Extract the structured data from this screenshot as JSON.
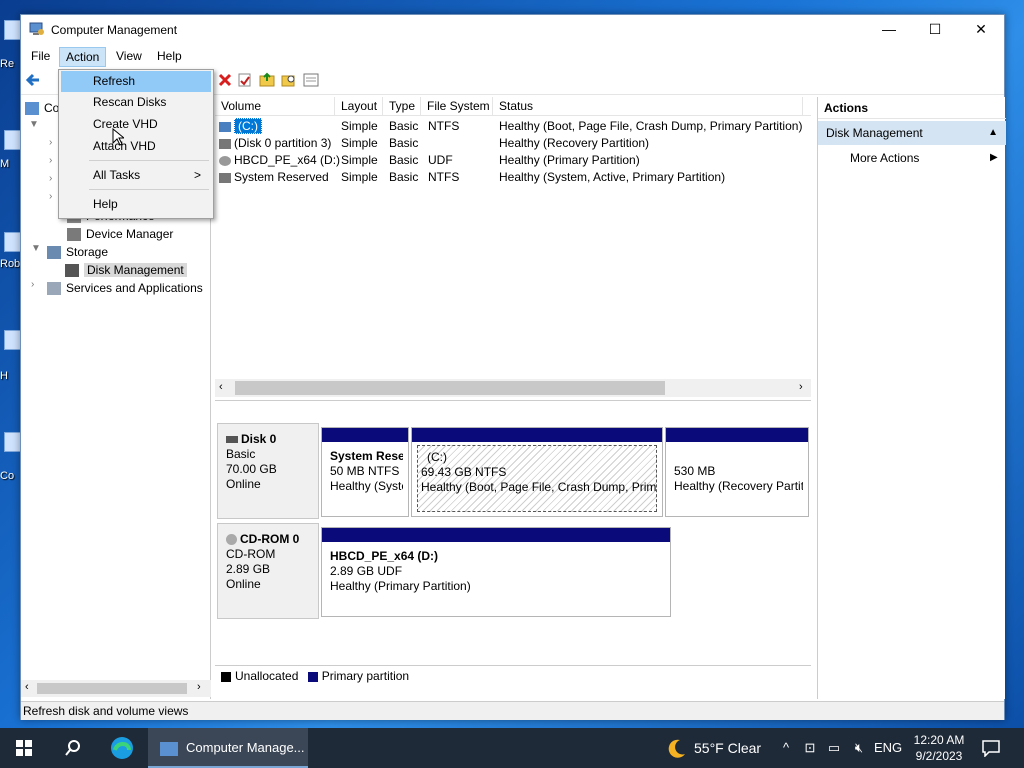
{
  "window": {
    "title": "Computer Management",
    "controls": {
      "minimize": "—",
      "maximize": "☐",
      "close": "✕"
    }
  },
  "menubar": {
    "items": [
      "File",
      "Action",
      "View",
      "Help"
    ]
  },
  "action_menu": {
    "items": [
      "Refresh",
      "Rescan Disks",
      "Create VHD",
      "Attach VHD",
      "All Tasks",
      "Help"
    ],
    "all_tasks_arrow": ">"
  },
  "tree": {
    "root_partial": "Co",
    "items": [
      {
        "label": "Performance"
      },
      {
        "label": "Device Manager"
      },
      {
        "label": "Storage"
      },
      {
        "label": "Disk Management"
      },
      {
        "label": "Services and Applications"
      }
    ]
  },
  "volumes": {
    "columns": [
      "Volume",
      "Layout",
      "Type",
      "File System",
      "Status"
    ],
    "rows": [
      {
        "volume": "(C:)",
        "layout": "Simple",
        "type": "Basic",
        "fs": "NTFS",
        "status": "Healthy (Boot, Page File, Crash Dump, Primary Partition)"
      },
      {
        "volume": "(Disk 0 partition 3)",
        "layout": "Simple",
        "type": "Basic",
        "fs": "",
        "status": "Healthy (Recovery Partition)"
      },
      {
        "volume": "HBCD_PE_x64 (D:)",
        "layout": "Simple",
        "type": "Basic",
        "fs": "UDF",
        "status": "Healthy (Primary Partition)"
      },
      {
        "volume": "System Reserved",
        "layout": "Simple",
        "type": "Basic",
        "fs": "NTFS",
        "status": "Healthy (System, Active, Primary Partition)"
      }
    ]
  },
  "disks": [
    {
      "name": "Disk 0",
      "kind": "Basic",
      "size": "70.00 GB",
      "state": "Online",
      "partitions": [
        {
          "name": "System Reser",
          "line2": "50 MB NTFS",
          "line3": "Healthy (Syste"
        },
        {
          "name": "(C:)",
          "line2": "69.43 GB NTFS",
          "line3": "Healthy (Boot, Page File, Crash Dump, Primar"
        },
        {
          "name": "",
          "line2": "530 MB",
          "line3": "Healthy (Recovery Partit"
        }
      ]
    },
    {
      "name": "CD-ROM 0",
      "kind": "CD-ROM",
      "size": "2.89 GB",
      "state": "Online",
      "partitions": [
        {
          "name": "HBCD_PE_x64  (D:)",
          "line2": "2.89 GB UDF",
          "line3": "Healthy (Primary Partition)"
        }
      ]
    }
  ],
  "legend": {
    "unallocated": "Unallocated",
    "primary": "Primary partition",
    "unallocated_color": "#000000",
    "primary_color": "#0a0a7a"
  },
  "actions": {
    "title": "Actions",
    "section": "Disk Management",
    "more": "More Actions"
  },
  "statusbar": {
    "text": "Refresh disk and volume views"
  },
  "taskbar": {
    "app_label": "Computer Manage...",
    "weather": "55°F  Clear",
    "language": "ENG",
    "time": "12:20 AM",
    "date": "9/2/2023"
  },
  "desktop": {
    "labels": [
      "Re",
      "M",
      "Rob",
      "H",
      "Co"
    ]
  },
  "colors": {
    "accent": "#0078d7",
    "menu_hover": "#91c9f7",
    "partition_header": "#0a0a7a",
    "actions_highlight": "#d5e4f2"
  }
}
